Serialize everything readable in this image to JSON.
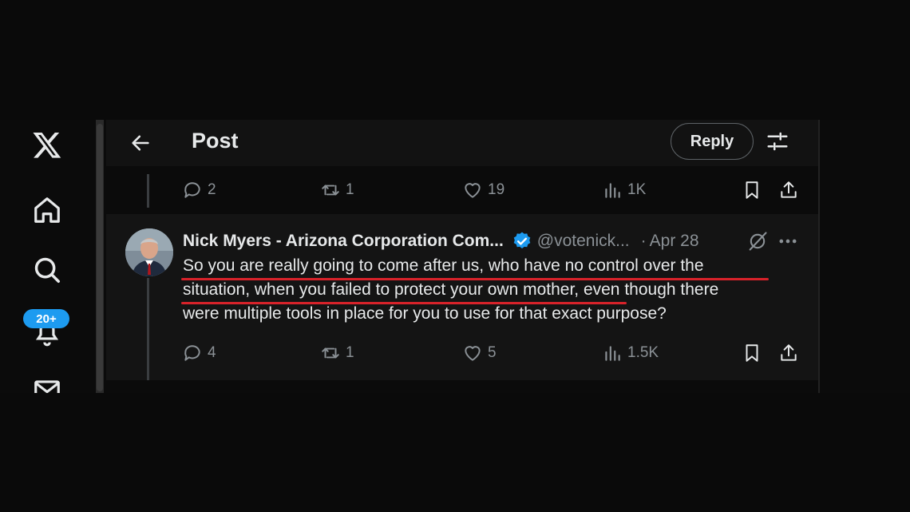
{
  "header": {
    "title": "Post",
    "reply_button": "Reply"
  },
  "nav": {
    "notifications_badge": "20+"
  },
  "previous_post_actions": {
    "replies": "2",
    "reposts": "1",
    "likes": "19",
    "views": "1K"
  },
  "tweet": {
    "author_name": "Nick Myers - Arizona Corporation Com...",
    "handle": "@votenick...",
    "separator": "·",
    "date": "Apr 28",
    "lines": [
      "So you are really going to come after us, who have no control over the",
      "situation, when you failed to protect your own mother, even though there",
      "were multiple tools in place for you to use for that exact purpose?"
    ],
    "actions": {
      "replies": "4",
      "reposts": "1",
      "likes": "5",
      "views": "1.5K"
    }
  },
  "colors": {
    "background": "#000000",
    "text": "#e7e9ea",
    "muted": "#8b9196",
    "accent_blue": "#1d9bf0",
    "underline_red": "#d8222a"
  },
  "icons": [
    "x-logo-icon",
    "home-icon",
    "search-icon",
    "bell-icon",
    "mail-icon",
    "back-arrow-icon",
    "settings-sliders-icon",
    "reply-icon",
    "repost-icon",
    "like-icon",
    "views-icon",
    "bookmark-icon",
    "share-icon",
    "verified-icon",
    "grok-icon",
    "more-icon"
  ]
}
